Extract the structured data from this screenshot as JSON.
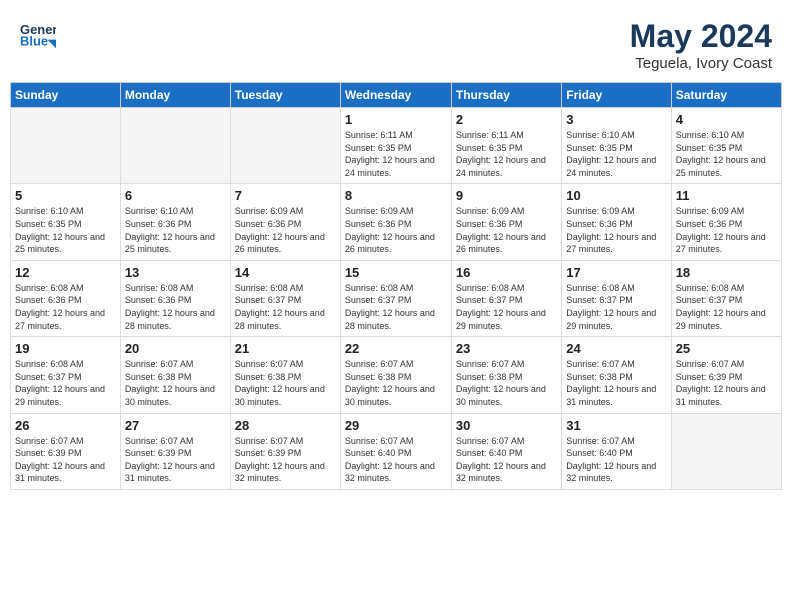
{
  "header": {
    "logo_line1": "General",
    "logo_line2": "Blue",
    "month_year": "May 2024",
    "location": "Teguela, Ivory Coast"
  },
  "weekdays": [
    "Sunday",
    "Monday",
    "Tuesday",
    "Wednesday",
    "Thursday",
    "Friday",
    "Saturday"
  ],
  "weeks": [
    [
      {
        "day": "",
        "info": ""
      },
      {
        "day": "",
        "info": ""
      },
      {
        "day": "",
        "info": ""
      },
      {
        "day": "1",
        "info": "Sunrise: 6:11 AM\nSunset: 6:35 PM\nDaylight: 12 hours and 24 minutes."
      },
      {
        "day": "2",
        "info": "Sunrise: 6:11 AM\nSunset: 6:35 PM\nDaylight: 12 hours and 24 minutes."
      },
      {
        "day": "3",
        "info": "Sunrise: 6:10 AM\nSunset: 6:35 PM\nDaylight: 12 hours and 24 minutes."
      },
      {
        "day": "4",
        "info": "Sunrise: 6:10 AM\nSunset: 6:35 PM\nDaylight: 12 hours and 25 minutes."
      }
    ],
    [
      {
        "day": "5",
        "info": "Sunrise: 6:10 AM\nSunset: 6:35 PM\nDaylight: 12 hours and 25 minutes."
      },
      {
        "day": "6",
        "info": "Sunrise: 6:10 AM\nSunset: 6:36 PM\nDaylight: 12 hours and 25 minutes."
      },
      {
        "day": "7",
        "info": "Sunrise: 6:09 AM\nSunset: 6:36 PM\nDaylight: 12 hours and 26 minutes."
      },
      {
        "day": "8",
        "info": "Sunrise: 6:09 AM\nSunset: 6:36 PM\nDaylight: 12 hours and 26 minutes."
      },
      {
        "day": "9",
        "info": "Sunrise: 6:09 AM\nSunset: 6:36 PM\nDaylight: 12 hours and 26 minutes."
      },
      {
        "day": "10",
        "info": "Sunrise: 6:09 AM\nSunset: 6:36 PM\nDaylight: 12 hours and 27 minutes."
      },
      {
        "day": "11",
        "info": "Sunrise: 6:09 AM\nSunset: 6:36 PM\nDaylight: 12 hours and 27 minutes."
      }
    ],
    [
      {
        "day": "12",
        "info": "Sunrise: 6:08 AM\nSunset: 6:36 PM\nDaylight: 12 hours and 27 minutes."
      },
      {
        "day": "13",
        "info": "Sunrise: 6:08 AM\nSunset: 6:36 PM\nDaylight: 12 hours and 28 minutes."
      },
      {
        "day": "14",
        "info": "Sunrise: 6:08 AM\nSunset: 6:37 PM\nDaylight: 12 hours and 28 minutes."
      },
      {
        "day": "15",
        "info": "Sunrise: 6:08 AM\nSunset: 6:37 PM\nDaylight: 12 hours and 28 minutes."
      },
      {
        "day": "16",
        "info": "Sunrise: 6:08 AM\nSunset: 6:37 PM\nDaylight: 12 hours and 29 minutes."
      },
      {
        "day": "17",
        "info": "Sunrise: 6:08 AM\nSunset: 6:37 PM\nDaylight: 12 hours and 29 minutes."
      },
      {
        "day": "18",
        "info": "Sunrise: 6:08 AM\nSunset: 6:37 PM\nDaylight: 12 hours and 29 minutes."
      }
    ],
    [
      {
        "day": "19",
        "info": "Sunrise: 6:08 AM\nSunset: 6:37 PM\nDaylight: 12 hours and 29 minutes."
      },
      {
        "day": "20",
        "info": "Sunrise: 6:07 AM\nSunset: 6:38 PM\nDaylight: 12 hours and 30 minutes."
      },
      {
        "day": "21",
        "info": "Sunrise: 6:07 AM\nSunset: 6:38 PM\nDaylight: 12 hours and 30 minutes."
      },
      {
        "day": "22",
        "info": "Sunrise: 6:07 AM\nSunset: 6:38 PM\nDaylight: 12 hours and 30 minutes."
      },
      {
        "day": "23",
        "info": "Sunrise: 6:07 AM\nSunset: 6:38 PM\nDaylight: 12 hours and 30 minutes."
      },
      {
        "day": "24",
        "info": "Sunrise: 6:07 AM\nSunset: 6:38 PM\nDaylight: 12 hours and 31 minutes."
      },
      {
        "day": "25",
        "info": "Sunrise: 6:07 AM\nSunset: 6:39 PM\nDaylight: 12 hours and 31 minutes."
      }
    ],
    [
      {
        "day": "26",
        "info": "Sunrise: 6:07 AM\nSunset: 6:39 PM\nDaylight: 12 hours and 31 minutes."
      },
      {
        "day": "27",
        "info": "Sunrise: 6:07 AM\nSunset: 6:39 PM\nDaylight: 12 hours and 31 minutes."
      },
      {
        "day": "28",
        "info": "Sunrise: 6:07 AM\nSunset: 6:39 PM\nDaylight: 12 hours and 32 minutes."
      },
      {
        "day": "29",
        "info": "Sunrise: 6:07 AM\nSunset: 6:40 PM\nDaylight: 12 hours and 32 minutes."
      },
      {
        "day": "30",
        "info": "Sunrise: 6:07 AM\nSunset: 6:40 PM\nDaylight: 12 hours and 32 minutes."
      },
      {
        "day": "31",
        "info": "Sunrise: 6:07 AM\nSunset: 6:40 PM\nDaylight: 12 hours and 32 minutes."
      },
      {
        "day": "",
        "info": ""
      }
    ]
  ]
}
